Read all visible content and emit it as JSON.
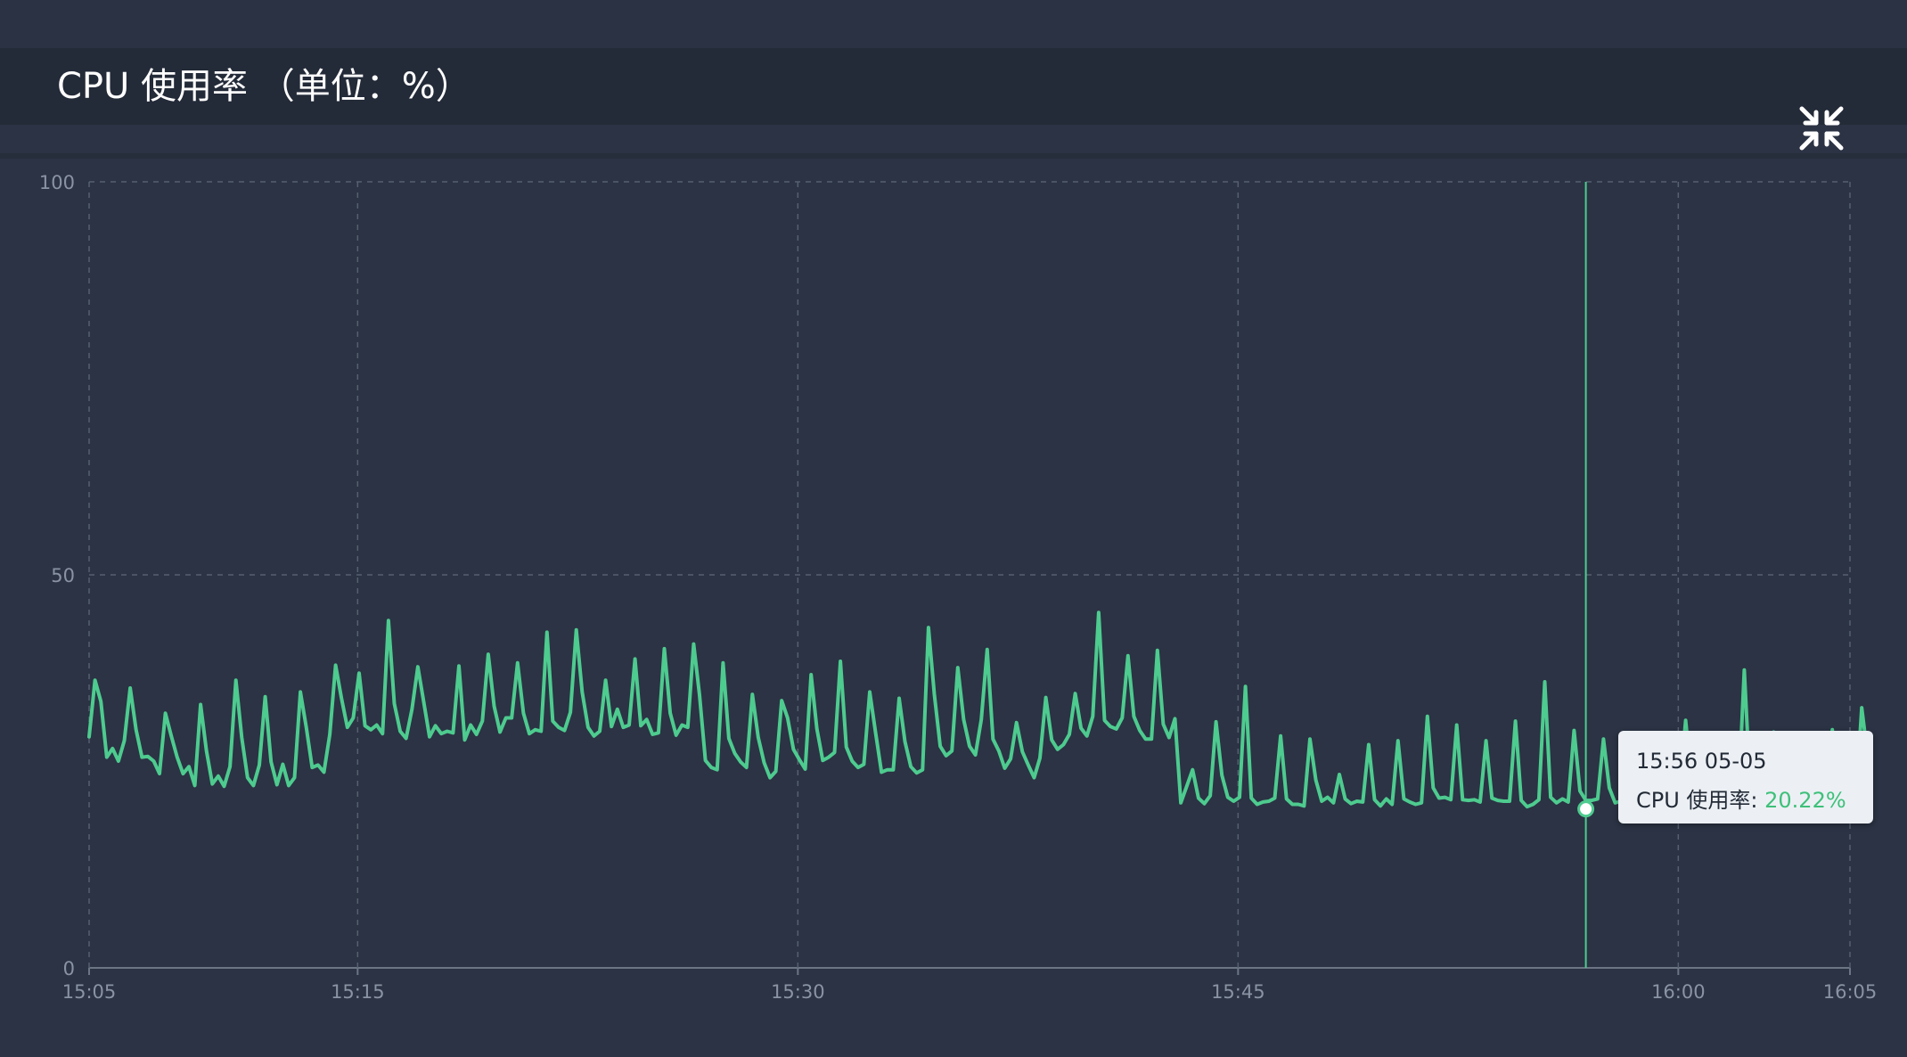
{
  "header": {
    "title": "CPU 使用率 （单位：%）",
    "collapse_icon": "collapse-arrows-icon"
  },
  "colors": {
    "line": "#4ecb8f",
    "crosshair": "#4ecb8f",
    "axis_text": "#8a93a3",
    "grid": "#56606f",
    "tooltip_value": "#3ec07a"
  },
  "tooltip": {
    "time": "15:56 05-05",
    "label": "CPU 使用率: ",
    "value": "20.22%"
  },
  "chart_data": {
    "type": "line",
    "title": "CPU 使用率 （单位：%）",
    "xlabel": "",
    "ylabel": "",
    "ylim": [
      0,
      100
    ],
    "yticks": [
      "0",
      "50",
      "100"
    ],
    "xlim_minutes": [
      0,
      60
    ],
    "xticks": [
      {
        "label": "15:05",
        "minute": 0
      },
      {
        "label": "15:15",
        "minute": 9.15
      },
      {
        "label": "15:30",
        "minute": 24.15
      },
      {
        "label": "15:45",
        "minute": 39.15
      },
      {
        "label": "16:00",
        "minute": 54.15
      },
      {
        "label": "16:05",
        "minute": 60
      }
    ],
    "grid": true,
    "crosshair_minute": 51.0,
    "highlight": {
      "minute": 51.0,
      "value": 20.22
    },
    "series": [
      {
        "values_step_minutes": 0.2,
        "values": [
          29.4,
          36.6,
          33.9,
          26.8,
          27.9,
          26.3,
          28.9,
          35.6,
          30.3,
          26.8,
          26.9,
          26.3,
          24.7,
          32.4,
          29.5,
          26.8,
          24.7,
          25.6,
          23.2,
          33.5,
          27.6,
          23.4,
          24.4,
          23.1,
          25.6,
          36.6,
          29.3,
          24.2,
          23.2,
          25.8,
          34.5,
          26.2,
          23.3,
          25.9,
          23.2,
          24.2,
          35.1,
          30.6,
          25.5,
          25.8,
          24.9,
          29.7,
          38.5,
          34.3,
          30.6,
          31.8,
          37.5,
          30.8,
          30.3,
          30.9,
          29.8,
          44.2,
          33.6,
          30.1,
          29.2,
          32.9,
          38.3,
          33.9,
          29.4,
          30.8,
          29.8,
          30.1,
          29.9,
          38.4,
          29.0,
          30.9,
          29.7,
          31.4,
          39.9,
          33.3,
          30.0,
          31.8,
          31.8,
          38.8,
          32.4,
          29.8,
          30.3,
          30.1,
          42.7,
          31.4,
          30.6,
          30.2,
          32.5,
          43.0,
          35.1,
          30.6,
          29.5,
          30.1,
          36.6,
          30.7,
          32.9,
          30.6,
          30.9,
          39.3,
          30.8,
          31.6,
          29.7,
          29.9,
          40.6,
          32.4,
          29.6,
          30.9,
          30.6,
          41.2,
          34.7,
          26.4,
          25.5,
          25.2,
          38.8,
          29.2,
          27.3,
          26.2,
          25.5,
          34.8,
          29.3,
          26.1,
          24.2,
          25.0,
          34.0,
          31.8,
          27.8,
          26.5,
          25.3,
          37.3,
          30.4,
          26.4,
          26.8,
          27.4,
          39.0,
          28.1,
          26.3,
          25.5,
          25.9,
          35.1,
          29.9,
          24.9,
          25.2,
          25.2,
          34.3,
          28.8,
          25.6,
          24.8,
          25.2,
          43.3,
          34.8,
          28.2,
          27.0,
          27.6,
          38.2,
          31.6,
          28.2,
          27.1,
          31.6,
          40.5,
          29.1,
          27.6,
          25.4,
          26.6,
          31.2,
          27.5,
          25.8,
          24.2,
          26.7,
          34.4,
          29.0,
          27.8,
          28.4,
          29.7,
          34.9,
          30.5,
          29.5,
          32.0,
          45.2,
          31.5,
          30.7,
          30.4,
          31.8,
          39.7,
          32.0,
          30.2,
          29.1,
          29.1,
          40.4,
          31.0,
          29.3,
          31.7,
          21.0,
          23.1,
          25.2,
          21.6,
          20.9,
          21.9,
          31.3,
          24.5,
          21.7,
          21.2,
          21.7,
          35.8,
          21.6,
          20.8,
          21.1,
          21.2,
          21.6,
          29.5,
          21.5,
          20.8,
          20.8,
          20.6,
          29.1,
          23.9,
          21.2,
          21.7,
          21.0,
          24.6,
          21.5,
          20.9,
          21.2,
          21.1,
          28.4,
          21.4,
          20.6,
          21.5,
          20.8,
          28.9,
          21.5,
          21.1,
          20.8,
          21.0,
          32.0,
          22.9,
          21.6,
          21.7,
          21.4,
          30.9,
          21.4,
          21.3,
          21.4,
          21.1,
          28.9,
          21.6,
          21.3,
          21.2,
          21.2,
          31.4,
          21.3,
          20.5,
          20.8,
          21.4,
          36.4,
          21.7,
          21.0,
          21.5,
          21.1,
          30.2,
          22.5,
          21.3,
          21.3,
          21.5,
          29.1,
          22.9,
          21.0,
          21.2,
          20.7,
          29.5,
          21.9,
          20.9,
          21.2,
          21.0,
          26.5,
          21.3,
          20.22,
          22.7,
          31.5,
          23.6,
          21.3,
          21.5,
          20.7,
          23.1,
          20.9,
          20.7,
          21.3,
          21.6,
          37.9,
          23.0,
          20.9,
          21.3,
          20.8,
          30.0,
          21.4,
          21.5,
          20.8,
          21.0,
          29.5,
          21.4,
          21.2,
          20.9,
          21.0,
          30.3,
          22.7,
          21.4,
          21.1,
          21.3,
          33.1,
          27.0
        ]
      }
    ]
  }
}
